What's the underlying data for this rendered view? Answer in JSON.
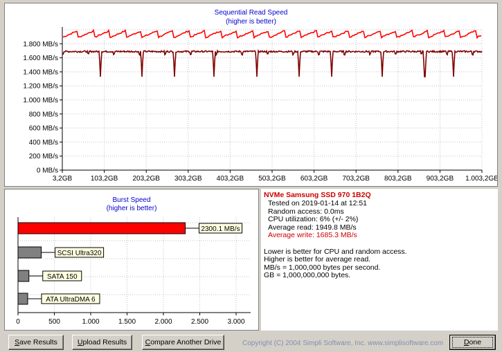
{
  "sequential": {
    "title": "Sequential Read Speed",
    "subtitle": "(higher is better)",
    "y_ticks": [
      "1.800 MB/s",
      "1.600 MB/s",
      "1.400 MB/s",
      "1.200 MB/s",
      "1.000 MB/s",
      "800 MB/s",
      "600 MB/s",
      "400 MB/s",
      "200 MB/s",
      "0 MB/s"
    ],
    "x_ticks": [
      "3,2GB",
      "103,2GB",
      "203,2GB",
      "303,2GB",
      "403,2GB",
      "503,2GB",
      "603,2GB",
      "703,2GB",
      "803,2GB",
      "903,2GB",
      "1.003,2GB"
    ]
  },
  "burst": {
    "title": "Burst Speed",
    "subtitle": "(higher is better)",
    "x_ticks": [
      "0",
      "500",
      "1.000",
      "1.500",
      "2.000",
      "2.500",
      "3.000"
    ]
  },
  "chart_data": [
    {
      "type": "line",
      "title": "Sequential Read Speed",
      "subtitle": "(higher is better)",
      "xlabel": "",
      "ylabel": "",
      "x_range_gb": [
        3.2,
        1003.2
      ],
      "ylim": [
        0,
        2000
      ],
      "grid": true,
      "series": [
        {
          "color": "#ff0000",
          "typical_value": 1950,
          "range": [
            1880,
            2000
          ]
        },
        {
          "color": "#800000",
          "typical_value": 1690,
          "dip_value": 1330,
          "dip_positions_gb": [
            94,
            193,
            270,
            365,
            467,
            568,
            645,
            766,
            867,
            935
          ]
        }
      ]
    },
    {
      "type": "bar",
      "orientation": "horizontal",
      "title": "Burst Speed",
      "subtitle": "(higher is better)",
      "xlim": [
        0,
        3200
      ],
      "grid": true,
      "bars": [
        {
          "label": "2300.1 MB/s",
          "value": 2300.1,
          "color": "#ff0000"
        },
        {
          "label": "SCSI Ultra320",
          "value": 320,
          "color": "#808080"
        },
        {
          "label": "SATA 150",
          "value": 150,
          "color": "#808080"
        },
        {
          "label": "ATA UltraDMA 6",
          "value": 133,
          "color": "#808080"
        }
      ]
    }
  ],
  "info": {
    "drive_name": "NVMe Samsung SSD 970 1B2Q",
    "tested": "Tested on 2019-01-14 at 12:51",
    "random_access": "Random access: 0.0ms",
    "cpu": "CPU utilization: 6% (+/- 2%)",
    "avg_read": "Average read: 1949.8 MB/s",
    "avg_write": "Average write: 1685.3 MB/s",
    "note1": "Lower is better for CPU and random access.",
    "note2": "Higher is better for average read.",
    "note3": "MB/s = 1,000,000 bytes per second.",
    "note4": "GB = 1,000,000,000 bytes."
  },
  "buttons": {
    "save_prefix": "S",
    "save_rest": "ave Results",
    "upload_prefix": "U",
    "upload_rest": "pload Results",
    "compare_prefix": "C",
    "compare_rest": "ompare Another Drive",
    "done_prefix": "D",
    "done_rest": "one"
  },
  "copyright": "Copyright (C) 2004 Simpli Software, Inc. www.simplisoftware.com",
  "colors": {
    "title": "#0000cc",
    "read_line": "#ff0000",
    "write_line": "#800000",
    "highlight": "#cc0000",
    "label_bg": "#ffffe1"
  }
}
